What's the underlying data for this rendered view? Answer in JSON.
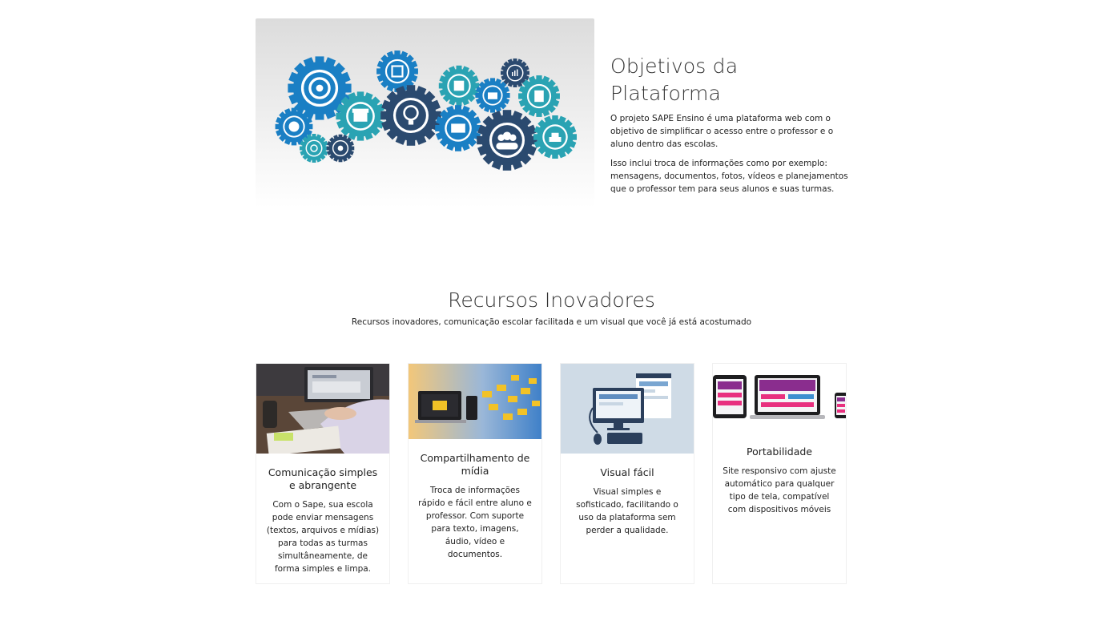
{
  "about": {
    "title": "Objetivos da Plataforma",
    "paragraph_1": "O projeto SAPE Ensino é uma plataforma web com o objetivo de simplificar o acesso entre o professor e o aluno dentro das escolas.",
    "paragraph_2": "Isso inclui troca de informações como por exemplo: mensagens, documentos, fotos, vídeos e planejamentos que o professor tem para seus alunos e suas turmas."
  },
  "features": {
    "title": "Recursos Inovadores",
    "subtitle": "Recursos inovadores, comunicação escolar facilitada e um visual que você já está acostumado",
    "cards": [
      {
        "title": "Comunicação simples e abrangente",
        "text": "Com o Sape, sua escola pode enviar mensagens (textos, arquivos e mídias) para todas as turmas simultâneamente, de forma simples e limpa."
      },
      {
        "title": "Compartilhamento de mídia",
        "text": "Troca de informações rápido e fácil entre aluno e professor. Com suporte para texto, imagens, áudio, vídeo e documentos."
      },
      {
        "title": "Visual fácil",
        "text": "Visual simples e sofisticado, facilitando o uso da plataforma sem perder a qualidade."
      },
      {
        "title": "Portabilidade",
        "text": "Site responsivo com ajuste automático para qualquer tipo de tela, compatível com dispositivos móveis"
      }
    ]
  },
  "colors": {
    "gear_blue": "#1a7fc4",
    "gear_teal": "#2aa3b3",
    "gear_navy": "#2b4a6f",
    "text": "#222222"
  }
}
